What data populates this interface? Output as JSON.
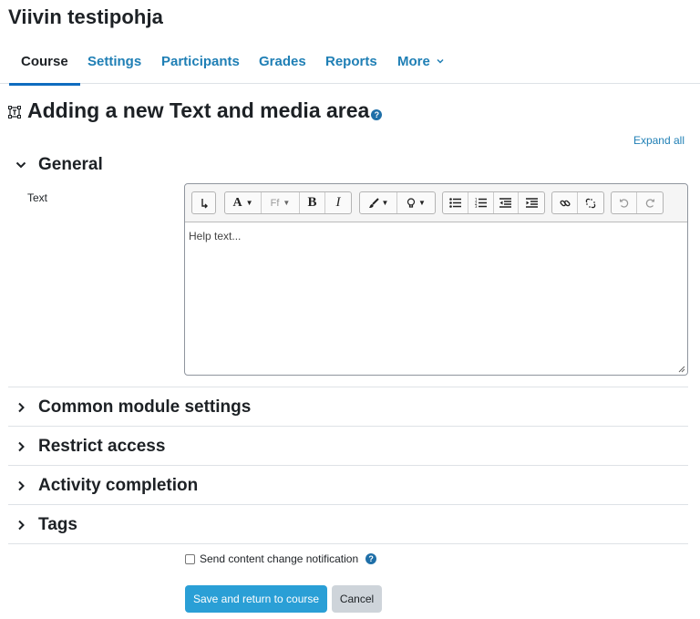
{
  "course": {
    "title": "Viivin testipohja"
  },
  "nav": {
    "tabs": [
      {
        "label": "Course",
        "active": true
      },
      {
        "label": "Settings"
      },
      {
        "label": "Participants"
      },
      {
        "label": "Grades"
      },
      {
        "label": "Reports"
      },
      {
        "label": "More",
        "icon": "chevron-down-icon"
      }
    ]
  },
  "page": {
    "heading": "Adding a new Text and media area",
    "icon": "text-media-icon",
    "help_icon": "help-icon",
    "expand_all": "Expand all"
  },
  "sections": {
    "general": {
      "title": "General",
      "expanded": true
    },
    "common": {
      "title": "Common module settings",
      "expanded": false
    },
    "restrict": {
      "title": "Restrict access",
      "expanded": false
    },
    "completion": {
      "title": "Activity completion",
      "expanded": false
    },
    "tags": {
      "title": "Tags",
      "expanded": false
    }
  },
  "text_field": {
    "label": "Text",
    "placeholder": "Help text...",
    "font_button": "Ff",
    "bold": "B",
    "italic": "I",
    "font_size_button": "A"
  },
  "notification": {
    "label": "Send content change notification",
    "checked": false
  },
  "actions": {
    "save": "Save and return to course",
    "cancel": "Cancel"
  },
  "colors": {
    "link": "#1f7fb5",
    "primary_button": "#2a9fd6",
    "secondary_button": "#ced4da",
    "active_tab_underline": "#0f6cbf"
  }
}
